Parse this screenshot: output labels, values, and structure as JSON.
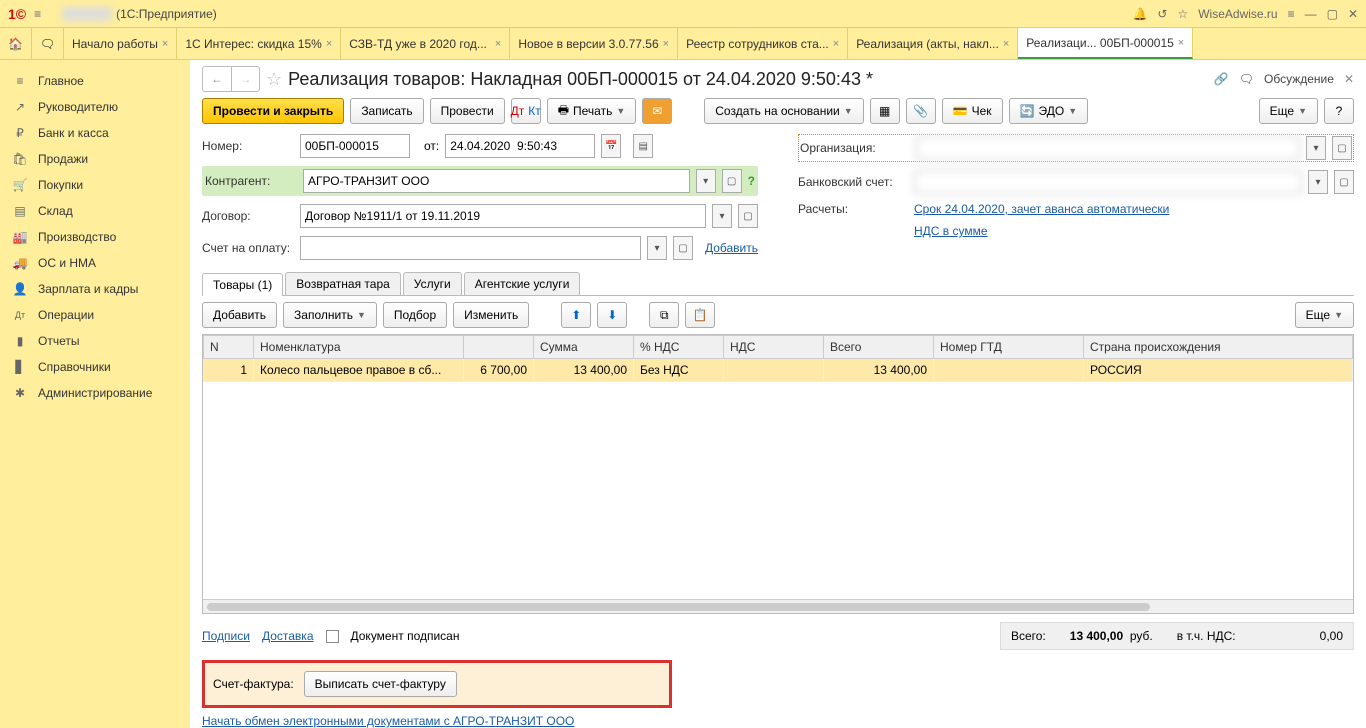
{
  "app": {
    "title_suffix": "(1С:Предприятие)",
    "site": "WiseAdwise.ru"
  },
  "tabs": [
    "Начало работы",
    "1С Интерес: скидка 15%",
    "СЗВ-ТД уже в 2020 год...",
    "Новое в версии 3.0.77.56",
    "Реестр сотрудников ста...",
    "Реализация (акты, накл...",
    "Реализаци... 00БП-000015"
  ],
  "sidebar": [
    {
      "icon": "≡",
      "label": "Главное"
    },
    {
      "icon": "↗",
      "label": "Руководителю"
    },
    {
      "icon": "₽",
      "label": "Банк и касса"
    },
    {
      "icon": "🛍",
      "label": "Продажи"
    },
    {
      "icon": "🛒",
      "label": "Покупки"
    },
    {
      "icon": "▤",
      "label": "Склад"
    },
    {
      "icon": "🏭",
      "label": "Производство"
    },
    {
      "icon": "🚚",
      "label": "ОС и НМА"
    },
    {
      "icon": "👤",
      "label": "Зарплата и кадры"
    },
    {
      "icon": "Дт",
      "label": "Операции"
    },
    {
      "icon": "▮",
      "label": "Отчеты"
    },
    {
      "icon": "▋",
      "label": "Справочники"
    },
    {
      "icon": "✱",
      "label": "Администрирование"
    }
  ],
  "page": {
    "title": "Реализация товаров: Накладная 00БП-000015 от 24.04.2020 9:50:43 *",
    "discuss": "Обсуждение"
  },
  "toolbar": {
    "post_close": "Провести и закрыть",
    "save": "Записать",
    "post": "Провести",
    "dtkt": "Дт Кт",
    "print": "Печать",
    "create_based": "Создать на основании",
    "check": "Чек",
    "edo": "ЭДО",
    "more": "Еще"
  },
  "form": {
    "number_lbl": "Номер:",
    "number": "00БП-000015",
    "from_lbl": "от:",
    "date": "24.04.2020  9:50:43",
    "contragent_lbl": "Контрагент:",
    "contragent": "АГРО-ТРАНЗИТ ООО",
    "contract_lbl": "Договор:",
    "contract": "Договор №1911/1 от 19.11.2019",
    "invoice_for_lbl": "Счет на оплату:",
    "org_lbl": "Организация:",
    "bank_lbl": "Банковский счет:",
    "settle_lbl": "Расчеты:",
    "settle_link": "Срок 24.04.2020, зачет аванса автоматически",
    "vat_link": "НДС в сумме",
    "add_link": "Добавить"
  },
  "innerTabs": [
    "Товары (1)",
    "Возвратная тара",
    "Услуги",
    "Агентские услуги"
  ],
  "tabToolbar": {
    "add": "Добавить",
    "fill": "Заполнить",
    "pick": "Подбор",
    "change": "Изменить",
    "more": "Еще"
  },
  "table": {
    "headers": [
      "N",
      "Номенклатура",
      "Сумма",
      "% НДС",
      "НДС",
      "Всего",
      "Номер ГТД",
      "Страна происхождения"
    ],
    "row": {
      "n": "1",
      "nomen": "Колесо пальцевое правое в сб...",
      "price": "6 700,00",
      "sum": "13 400,00",
      "vat_rate": "Без НДС",
      "vat": "",
      "total": "13 400,00",
      "gtd": "",
      "country": "РОССИЯ"
    }
  },
  "footer": {
    "signatures": "Подписи",
    "delivery": "Доставка",
    "signed": "Документ подписан",
    "total_lbl": "Всего:",
    "total": "13 400,00",
    "rub": "руб.",
    "vat_incl": "в т.ч. НДС:",
    "vat_val": "0,00",
    "sf_lbl": "Счет-фактура:",
    "sf_btn": "Выписать счет-фактуру",
    "exchange": "Начать обмен электронными документами с АГРО-ТРАНЗИТ ООО"
  }
}
